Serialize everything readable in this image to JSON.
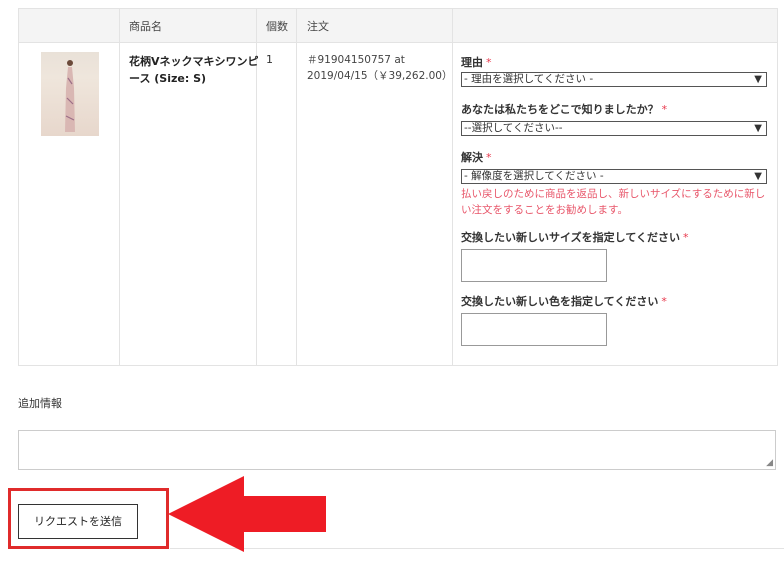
{
  "table": {
    "headers": {
      "product": "商品名",
      "qty": "個数",
      "order": "注文"
    },
    "row": {
      "product_name": "花柄Vネックマキシワンピース (Size: S)",
      "quantity": "1",
      "order_line1": "＃91904150757 at",
      "order_line2": "2019/04/15（￥39,262.00）"
    }
  },
  "form": {
    "reason_label": "理由",
    "reason_value": "- 理由を選択してください -",
    "source_label": "あなたは私たちをどこで知りましたか？",
    "source_value": "--選択してください--",
    "resolution_label": "解決",
    "resolution_value": "- 解像度を選択してください -",
    "resolution_hint": "払い戻しのために商品を返品し、新しいサイズにするために新しい注文をすることをお勧めします。",
    "size_label": "交換したい新しいサイズを指定してください",
    "color_label": "交換したい新しい色を指定してください",
    "required_mark": "*",
    "dropdown_icon": "▼"
  },
  "additional_info_label": "追加情報",
  "submit_label": "リクエストを送信",
  "colors": {
    "required": "#e8394d",
    "highlight": "#e02b2b",
    "hint": "#e8566a"
  }
}
